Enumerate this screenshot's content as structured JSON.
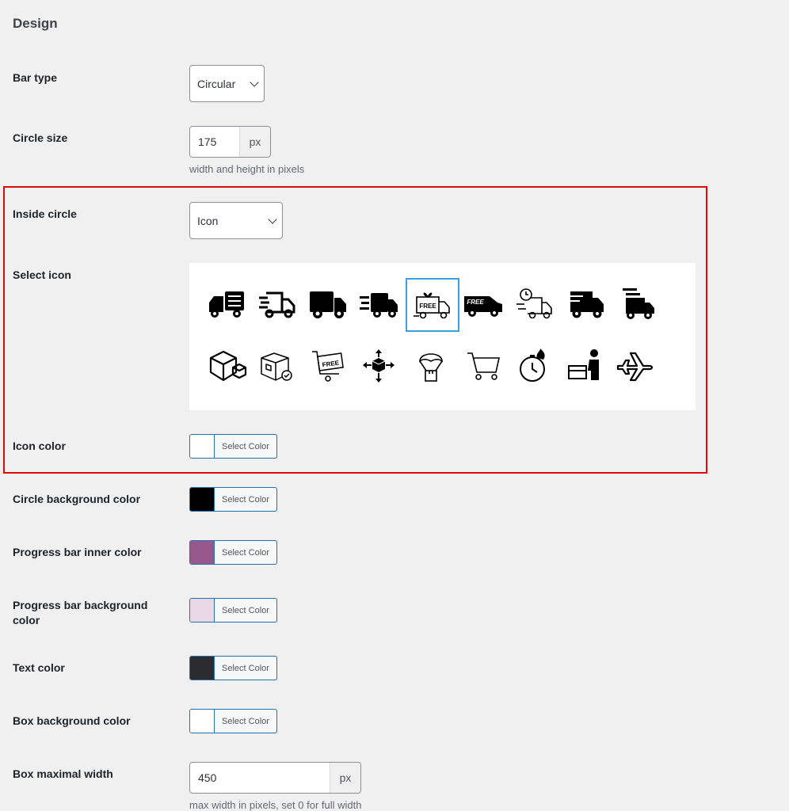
{
  "section": {
    "title": "Design"
  },
  "bar_type": {
    "label": "Bar type",
    "value": "Circular"
  },
  "circle_size": {
    "label": "Circle size",
    "value": "175",
    "unit": "px",
    "description": "width and height in pixels"
  },
  "inside_circle": {
    "label": "Inside circle",
    "value": "Icon"
  },
  "select_icon": {
    "label": "Select icon",
    "selected": "free-gift-truck-icon",
    "icons_row1": [
      "delivery-truck-list-icon",
      "fast-truck-icon",
      "truck-icon",
      "speeding-truck-icon",
      "free-gift-truck-icon",
      "free-van-icon",
      "timed-delivery-truck-icon",
      "fast-moving-truck-icon",
      "express-truck-icon"
    ],
    "icons_row2": [
      "package-box-icon",
      "package-check-icon",
      "free-cart-icon",
      "shipping-box-arrows-icon",
      "parachute-package-icon",
      "shopping-cart-icon",
      "stopwatch-fire-icon",
      "courier-delivery-icon",
      "airplane-icon"
    ],
    "free_text": "FREE"
  },
  "icon_color": {
    "label": "Icon color",
    "button": "Select Color",
    "swatch": "#ffffff"
  },
  "circle_bg_color": {
    "label": "Circle background color",
    "button": "Select Color",
    "swatch": "#000000"
  },
  "progress_inner_color": {
    "label": "Progress bar inner color",
    "button": "Select Color",
    "swatch": "#97588d"
  },
  "progress_bg_color": {
    "label": "Progress bar background color",
    "button": "Select Color",
    "swatch": "#ead7e6"
  },
  "text_color": {
    "label": "Text color",
    "button": "Select Color",
    "swatch": "#2b2c30"
  },
  "box_bg_color": {
    "label": "Box background color",
    "button": "Select Color",
    "swatch": "#ffffff"
  },
  "box_max_width": {
    "label": "Box maximal width",
    "value": "450",
    "unit": "px",
    "description": "max width in pixels, set 0 for full width"
  },
  "colors": {
    "highlight": "#e0080b",
    "selected_icon_border": "#3e9ce0",
    "button_border": "#2271b1"
  }
}
